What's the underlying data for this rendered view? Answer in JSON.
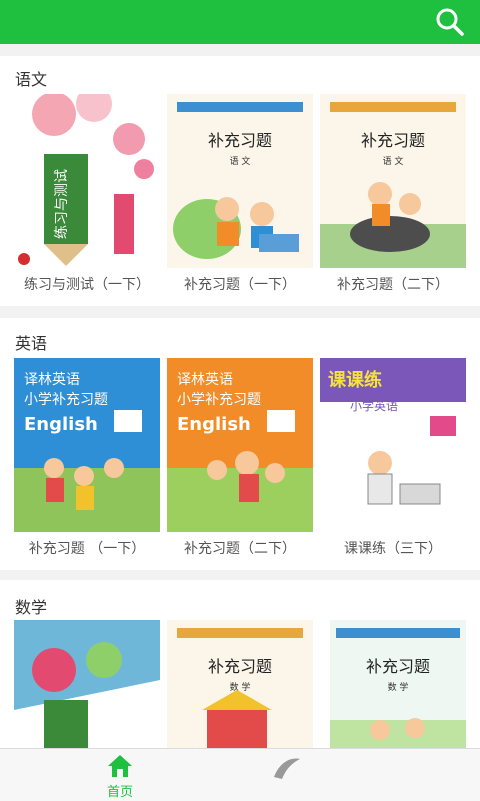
{
  "header": {
    "search_icon": "search-icon"
  },
  "sections": [
    {
      "title": "语文",
      "books": [
        {
          "caption": "练习与测试（一下）",
          "cover_title": "练习与测试",
          "cover_color": "#f3e6e6"
        },
        {
          "caption": "补充习题（一下）",
          "cover_title": "补充习题",
          "cover_sub": "语 文",
          "cover_color": "#cfe9f5"
        },
        {
          "caption": "补充习题（二下）",
          "cover_title": "补充习题",
          "cover_sub": "语 文",
          "cover_color": "#dbeee0"
        }
      ]
    },
    {
      "title": "英语",
      "books": [
        {
          "caption": "补充习题 （一下）",
          "cover_title": "译林英语\n小学补充习题",
          "cover_sub": "English",
          "cover_color": "#2e8fd6"
        },
        {
          "caption": "补充习题（二下）",
          "cover_title": "译林英语\n小学补充习题",
          "cover_sub": "English",
          "cover_color": "#f28c28"
        },
        {
          "caption": "课课练（三下）",
          "cover_title": "课课练",
          "cover_sub": "小学英语",
          "cover_color": "#7a57b8"
        }
      ]
    },
    {
      "title": "数学",
      "books": [
        {
          "caption": "",
          "cover_title": "",
          "cover_color": "#e6f2da"
        },
        {
          "caption": "",
          "cover_title": "补充习题",
          "cover_sub": "数 学",
          "cover_color": "#e9f4fb"
        },
        {
          "caption": "",
          "cover_title": "补充习题",
          "cover_sub": "数 学",
          "cover_color": "#eef7e6"
        }
      ]
    }
  ],
  "tabbar": {
    "home_label": "首页"
  },
  "colors": {
    "brand": "#1fbf3f"
  }
}
